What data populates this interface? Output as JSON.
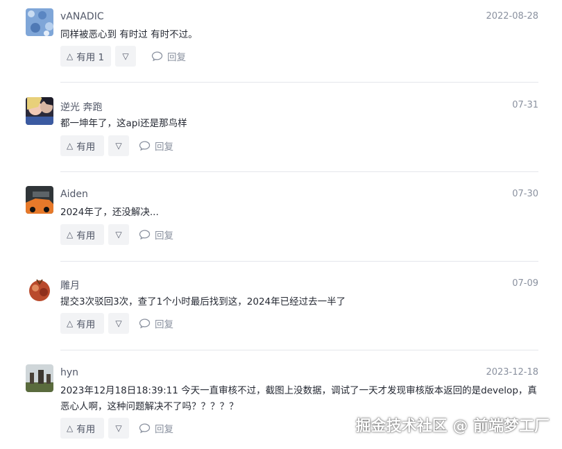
{
  "comments": [
    {
      "user": "vANADIC",
      "time": "2022-08-28",
      "text": "同样被恶心到 有时过 有时不过。",
      "like_label": "有用 1",
      "reply_label": "回复"
    },
    {
      "user": "逆光 奔跑",
      "time": "07-31",
      "text": "都一坤年了，这api还是那鸟样",
      "like_label": "有用",
      "reply_label": "回复"
    },
    {
      "user": "Aiden",
      "time": "07-30",
      "text": "2024年了，还没解决...",
      "like_label": "有用",
      "reply_label": "回复"
    },
    {
      "user": "雕月",
      "time": "07-09",
      "text": "提交3次驳回3次，查了1个小时最后找到这，2024年已经过去一半了",
      "like_label": "有用",
      "reply_label": "回复"
    },
    {
      "user": "hyn",
      "time": "2023-12-18",
      "text": "2023年12月18日18:39:11 今天一直审核不过，截图上没数据，调试了一天才发现审核版本返回的是develop，真恶心人啊，这种问题解决不了吗？？？？？",
      "like_label": "有用",
      "reply_label": "回复"
    }
  ],
  "watermark": "掘金技术社区 @ 前端梦工厂",
  "icons": {
    "up": "△",
    "down": "▽"
  }
}
